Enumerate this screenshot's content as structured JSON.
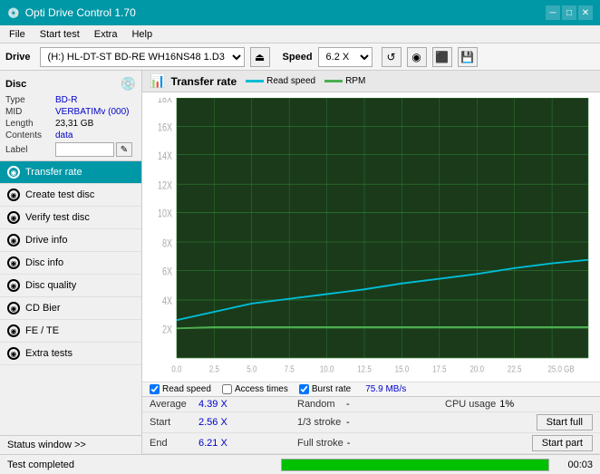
{
  "titlebar": {
    "title": "Opti Drive Control 1.70",
    "icon": "💿",
    "btn_min": "─",
    "btn_max": "□",
    "btn_close": "✕"
  },
  "menubar": {
    "items": [
      "File",
      "Start test",
      "Extra",
      "Help"
    ]
  },
  "drivebar": {
    "label": "Drive",
    "drive_value": "(H:)  HL-DT-ST BD-RE  WH16NS48 1.D3",
    "eject_icon": "⏏",
    "speed_label": "Speed",
    "speed_value": "6.2 X",
    "btn1": "🔄",
    "btn2": "💾",
    "btn3": "⚙"
  },
  "disc": {
    "title": "Disc",
    "type_key": "Type",
    "type_val": "BD-R",
    "mid_key": "MID",
    "mid_val": "VERBATIMv (000)",
    "length_key": "Length",
    "length_val": "23,31 GB",
    "contents_key": "Contents",
    "contents_val": "data",
    "label_key": "Label",
    "label_val": ""
  },
  "nav": {
    "items": [
      {
        "id": "transfer-rate",
        "label": "Transfer rate",
        "active": true
      },
      {
        "id": "create-test-disc",
        "label": "Create test disc",
        "active": false
      },
      {
        "id": "verify-test-disc",
        "label": "Verify test disc",
        "active": false
      },
      {
        "id": "drive-info",
        "label": "Drive info",
        "active": false
      },
      {
        "id": "disc-info",
        "label": "Disc info",
        "active": false
      },
      {
        "id": "disc-quality",
        "label": "Disc quality",
        "active": false
      },
      {
        "id": "cd-bier",
        "label": "CD Bier",
        "active": false
      },
      {
        "id": "fe-te",
        "label": "FE / TE",
        "active": false
      },
      {
        "id": "extra-tests",
        "label": "Extra tests",
        "active": false
      }
    ],
    "status_window": "Status window >>"
  },
  "chart": {
    "title": "Transfer rate",
    "legend": [
      {
        "label": "Read speed",
        "color": "#00bcd4"
      },
      {
        "label": "RPM",
        "color": "#4caf50"
      }
    ],
    "y_labels": [
      "18X",
      "16X",
      "14X",
      "12X",
      "10X",
      "8X",
      "6X",
      "4X",
      "2X"
    ],
    "x_labels": [
      "0.0",
      "2.5",
      "5.0",
      "7.5",
      "10.0",
      "12.5",
      "15.0",
      "17.5",
      "20.0",
      "22.5",
      "25.0 GB"
    ],
    "grid_color": "#2e7d32",
    "bg_color": "#1a3a1a"
  },
  "stats": {
    "read_speed_checked": true,
    "access_times_checked": false,
    "burst_rate_checked": true,
    "read_speed_label": "Read speed",
    "access_times_label": "Access times",
    "burst_rate_label": "Burst rate",
    "burst_rate_val": "75.9 MB/s"
  },
  "info_rows": [
    {
      "key1": "Average",
      "val1": "4.39 X",
      "key2": "Random",
      "val2": "-",
      "key3": "CPU usage",
      "val3": "1%"
    },
    {
      "key1": "Start",
      "val1": "2.56 X",
      "key2": "1/3 stroke",
      "val2": "-",
      "btn": "Start full"
    },
    {
      "key1": "End",
      "val1": "6.21 X",
      "key2": "Full stroke",
      "val2": "-",
      "btn": "Start part"
    }
  ],
  "statusbar": {
    "text": "Test completed",
    "progress": 100,
    "time": "00:03"
  }
}
